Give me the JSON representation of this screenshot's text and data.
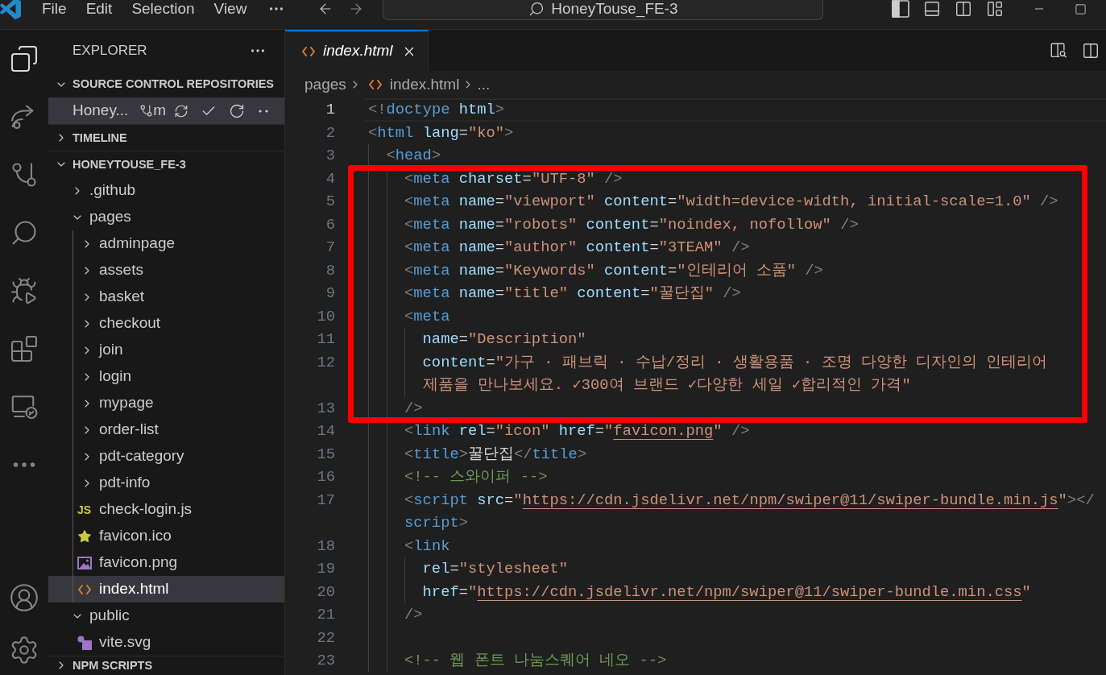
{
  "title_bar": {
    "menu": [
      "File",
      "Edit",
      "Selection",
      "View"
    ],
    "search": "HoneyTouse_FE-3"
  },
  "sidebar": {
    "title": "EXPLORER",
    "sections": [
      {
        "title": "SOURCE CONTROL REPOSITORIES",
        "expanded": true,
        "repos": [
          {
            "name": "Honey...",
            "branch": "m",
            "selected": true
          }
        ]
      },
      {
        "title": "TIMELINE",
        "expanded": false
      },
      {
        "title": "HONEYTOUSE_FE-3",
        "expanded": true,
        "items": [
          {
            "kind": "folder",
            "label": ".github",
            "expanded": false,
            "selected": false
          },
          {
            "kind": "folder",
            "label": "pages",
            "expanded": true,
            "selected": false,
            "children": [
              {
                "kind": "folder",
                "label": "adminpage",
                "expanded": false,
                "selected": false
              },
              {
                "kind": "folder",
                "label": "assets",
                "expanded": false,
                "selected": false
              },
              {
                "kind": "folder",
                "label": "basket",
                "expanded": false,
                "selected": false
              },
              {
                "kind": "folder",
                "label": "checkout",
                "expanded": false,
                "selected": false
              },
              {
                "kind": "folder",
                "label": "join",
                "expanded": false,
                "selected": false
              },
              {
                "kind": "folder",
                "label": "login",
                "expanded": false,
                "selected": false
              },
              {
                "kind": "folder",
                "label": "mypage",
                "expanded": false,
                "selected": false
              },
              {
                "kind": "folder",
                "label": "order-list",
                "expanded": false,
                "selected": false
              },
              {
                "kind": "folder",
                "label": "pdt-category",
                "expanded": false,
                "selected": false
              },
              {
                "kind": "folder",
                "label": "pdt-info",
                "expanded": false,
                "selected": false
              },
              {
                "kind": "script",
                "icon_text": "JS",
                "label": "check-login.js",
                "selected": false
              },
              {
                "kind": "favicon",
                "label": "favicon.ico",
                "selected": false
              },
              {
                "kind": "image",
                "label": "favicon.png",
                "selected": false
              },
              {
                "kind": "markup",
                "label": "index.html",
                "selected": true
              }
            ]
          },
          {
            "kind": "folder",
            "label": "public",
            "expanded": true,
            "selected": false,
            "children": [
              {
                "kind": "vector",
                "label": "vite.svg",
                "selected": false
              }
            ]
          }
        ]
      },
      {
        "title": "NPM SCRIPTS",
        "expanded": false
      }
    ]
  },
  "editor": {
    "tabs": [
      {
        "kind": "markup",
        "label": "index.html",
        "selected": true,
        "preview": true
      }
    ],
    "breadcrumb": [
      {
        "kind": "folder",
        "label": "pages"
      },
      {
        "kind": "markup",
        "label": "index.html"
      },
      {
        "kind": "more",
        "label": "..."
      }
    ],
    "blocks": [
      {
        "kind": "plain",
        "lines": [
          {
            "number": "1",
            "current": true,
            "rows": [
              [
                {
                  "kind": "punct",
                  "text": "<!"
                },
                {
                  "kind": "tag",
                  "text": "doctype"
                },
                {
                  "kind": "attr",
                  "text": " html"
                },
                {
                  "kind": "punct",
                  "text": ">"
                }
              ]
            ]
          },
          {
            "number": "2",
            "current": false,
            "rows": [
              [
                {
                  "kind": "punct",
                  "text": "<"
                },
                {
                  "kind": "tag",
                  "text": "html"
                },
                {
                  "kind": "attr",
                  "text": " lang"
                },
                {
                  "kind": "op",
                  "text": "="
                },
                {
                  "kind": "string",
                  "text": "\"ko\""
                },
                {
                  "kind": "punct",
                  "text": ">"
                }
              ]
            ]
          },
          {
            "number": "3",
            "current": false,
            "rows": [
              [
                {
                  "kind": "punct",
                  "text": "  <"
                },
                {
                  "kind": "tag",
                  "text": "head"
                },
                {
                  "kind": "punct",
                  "text": ">"
                }
              ]
            ]
          }
        ]
      },
      {
        "kind": "boxed",
        "lines": [
          {
            "number": "4",
            "current": false,
            "rows": [
              [
                {
                  "kind": "punct",
                  "text": "    <"
                },
                {
                  "kind": "tag",
                  "text": "meta"
                },
                {
                  "kind": "attr",
                  "text": " charset"
                },
                {
                  "kind": "op",
                  "text": "="
                },
                {
                  "kind": "string",
                  "text": "\"UTF-8\""
                },
                {
                  "kind": "punct",
                  "text": " />"
                }
              ]
            ]
          },
          {
            "number": "5",
            "current": false,
            "rows": [
              [
                {
                  "kind": "punct",
                  "text": "    <"
                },
                {
                  "kind": "tag",
                  "text": "meta"
                },
                {
                  "kind": "attr",
                  "text": " name"
                },
                {
                  "kind": "op",
                  "text": "="
                },
                {
                  "kind": "string",
                  "text": "\"viewport\""
                },
                {
                  "kind": "attr",
                  "text": " content"
                },
                {
                  "kind": "op",
                  "text": "="
                },
                {
                  "kind": "string",
                  "text": "\"width=device-width, initial-scale=1.0\""
                },
                {
                  "kind": "punct",
                  "text": " />"
                }
              ]
            ]
          },
          {
            "number": "6",
            "current": false,
            "rows": [
              [
                {
                  "kind": "punct",
                  "text": "    <"
                },
                {
                  "kind": "tag",
                  "text": "meta"
                },
                {
                  "kind": "attr",
                  "text": " name"
                },
                {
                  "kind": "op",
                  "text": "="
                },
                {
                  "kind": "string",
                  "text": "\"robots\""
                },
                {
                  "kind": "attr",
                  "text": " content"
                },
                {
                  "kind": "op",
                  "text": "="
                },
                {
                  "kind": "string",
                  "text": "\"noindex, nofollow\""
                },
                {
                  "kind": "punct",
                  "text": " />"
                }
              ]
            ]
          },
          {
            "number": "7",
            "current": false,
            "rows": [
              [
                {
                  "kind": "punct",
                  "text": "    <"
                },
                {
                  "kind": "tag",
                  "text": "meta"
                },
                {
                  "kind": "attr",
                  "text": " name"
                },
                {
                  "kind": "op",
                  "text": "="
                },
                {
                  "kind": "string",
                  "text": "\"author\""
                },
                {
                  "kind": "attr",
                  "text": " content"
                },
                {
                  "kind": "op",
                  "text": "="
                },
                {
                  "kind": "string",
                  "text": "\"3TEAM\""
                },
                {
                  "kind": "punct",
                  "text": " />"
                }
              ]
            ]
          },
          {
            "number": "8",
            "current": false,
            "rows": [
              [
                {
                  "kind": "punct",
                  "text": "    <"
                },
                {
                  "kind": "tag",
                  "text": "meta"
                },
                {
                  "kind": "attr",
                  "text": " name"
                },
                {
                  "kind": "op",
                  "text": "="
                },
                {
                  "kind": "string",
                  "text": "\"Keywords\""
                },
                {
                  "kind": "attr",
                  "text": " content"
                },
                {
                  "kind": "op",
                  "text": "="
                },
                {
                  "kind": "string",
                  "text": "\"인테리어 소품\""
                },
                {
                  "kind": "punct",
                  "text": " />"
                }
              ]
            ]
          },
          {
            "number": "9",
            "current": false,
            "rows": [
              [
                {
                  "kind": "punct",
                  "text": "    <"
                },
                {
                  "kind": "tag",
                  "text": "meta"
                },
                {
                  "kind": "attr",
                  "text": " name"
                },
                {
                  "kind": "op",
                  "text": "="
                },
                {
                  "kind": "string",
                  "text": "\"title\""
                },
                {
                  "kind": "attr",
                  "text": " content"
                },
                {
                  "kind": "op",
                  "text": "="
                },
                {
                  "kind": "string",
                  "text": "\"꿀단집\""
                },
                {
                  "kind": "punct",
                  "text": " />"
                }
              ]
            ]
          },
          {
            "number": "10",
            "current": false,
            "rows": [
              [
                {
                  "kind": "punct",
                  "text": "    <"
                },
                {
                  "kind": "tag",
                  "text": "meta"
                }
              ]
            ]
          },
          {
            "number": "11",
            "current": false,
            "rows": [
              [
                {
                  "kind": "attr",
                  "text": "      name"
                },
                {
                  "kind": "op",
                  "text": "="
                },
                {
                  "kind": "string",
                  "text": "\"Description\""
                }
              ]
            ]
          },
          {
            "number": "12",
            "current": false,
            "rows": [
              [
                {
                  "kind": "attr",
                  "text": "      content"
                },
                {
                  "kind": "op",
                  "text": "="
                },
                {
                  "kind": "string",
                  "text": "\"가구 · 패브릭 · 수납/정리 · 생활용품 · 조명 다양한 디자인의 인테리어"
                }
              ],
              [
                {
                  "kind": "string",
                  "text": "제품을 만나보세요. ✓300여 브랜드 ✓다양한 세일 ✓합리적인 가격\""
                }
              ]
            ]
          },
          {
            "number": "13",
            "current": false,
            "rows": [
              [
                {
                  "kind": "punct",
                  "text": "    />"
                }
              ]
            ]
          }
        ]
      },
      {
        "kind": "plain",
        "lines": [
          {
            "number": "14",
            "current": false,
            "rows": [
              [
                {
                  "kind": "punct",
                  "text": "    <"
                },
                {
                  "kind": "tag",
                  "text": "link"
                },
                {
                  "kind": "attr",
                  "text": " rel"
                },
                {
                  "kind": "op",
                  "text": "="
                },
                {
                  "kind": "string",
                  "text": "\"icon\""
                },
                {
                  "kind": "attr",
                  "text": " href"
                },
                {
                  "kind": "op",
                  "text": "="
                },
                {
                  "kind": "string",
                  "text": "\""
                },
                {
                  "kind": "link",
                  "text": "favicon.png"
                },
                {
                  "kind": "string",
                  "text": "\""
                },
                {
                  "kind": "punct",
                  "text": " />"
                }
              ]
            ]
          },
          {
            "number": "15",
            "current": false,
            "rows": [
              [
                {
                  "kind": "punct",
                  "text": "    <"
                },
                {
                  "kind": "tag",
                  "text": "title"
                },
                {
                  "kind": "punct",
                  "text": ">"
                },
                {
                  "kind": "text",
                  "text": "꿀단집"
                },
                {
                  "kind": "punct",
                  "text": "</"
                },
                {
                  "kind": "tag",
                  "text": "title"
                },
                {
                  "kind": "punct",
                  "text": ">"
                }
              ]
            ]
          },
          {
            "number": "16",
            "current": false,
            "rows": [
              [
                {
                  "kind": "comment",
                  "text": "    <!-- 스와이퍼 -->"
                }
              ]
            ]
          },
          {
            "number": "17",
            "current": false,
            "rows": [
              [
                {
                  "kind": "punct",
                  "text": "    <"
                },
                {
                  "kind": "tag",
                  "text": "script"
                },
                {
                  "kind": "attr",
                  "text": " src"
                },
                {
                  "kind": "op",
                  "text": "="
                },
                {
                  "kind": "string",
                  "text": "\""
                },
                {
                  "kind": "link",
                  "text": "https://cdn.jsdelivr.net/npm/swiper@11/swiper-bundle.min.js"
                },
                {
                  "kind": "string",
                  "text": "\""
                },
                {
                  "kind": "punct",
                  "text": "></"
                }
              ],
              [
                {
                  "kind": "tag",
                  "text": "script"
                },
                {
                  "kind": "punct",
                  "text": ">"
                }
              ]
            ]
          },
          {
            "number": "18",
            "current": false,
            "rows": [
              [
                {
                  "kind": "punct",
                  "text": "    <"
                },
                {
                  "kind": "tag",
                  "text": "link"
                }
              ]
            ]
          },
          {
            "number": "19",
            "current": false,
            "rows": [
              [
                {
                  "kind": "attr",
                  "text": "      rel"
                },
                {
                  "kind": "op",
                  "text": "="
                },
                {
                  "kind": "string",
                  "text": "\"stylesheet\""
                }
              ]
            ]
          },
          {
            "number": "20",
            "current": false,
            "rows": [
              [
                {
                  "kind": "attr",
                  "text": "      href"
                },
                {
                  "kind": "op",
                  "text": "="
                },
                {
                  "kind": "string",
                  "text": "\""
                },
                {
                  "kind": "link",
                  "text": "https://cdn.jsdelivr.net/npm/swiper@11/swiper-bundle.min.css"
                },
                {
                  "kind": "string",
                  "text": "\""
                }
              ]
            ]
          },
          {
            "number": "21",
            "current": false,
            "rows": [
              [
                {
                  "kind": "punct",
                  "text": "    />"
                }
              ]
            ]
          },
          {
            "number": "22",
            "current": false
          },
          {
            "number": "23",
            "current": false,
            "rows": [
              [
                {
                  "kind": "comment",
                  "text": "    <!-- 웹 폰트 나눔스퀘어 네오 -->"
                }
              ]
            ]
          }
        ]
      }
    ]
  }
}
